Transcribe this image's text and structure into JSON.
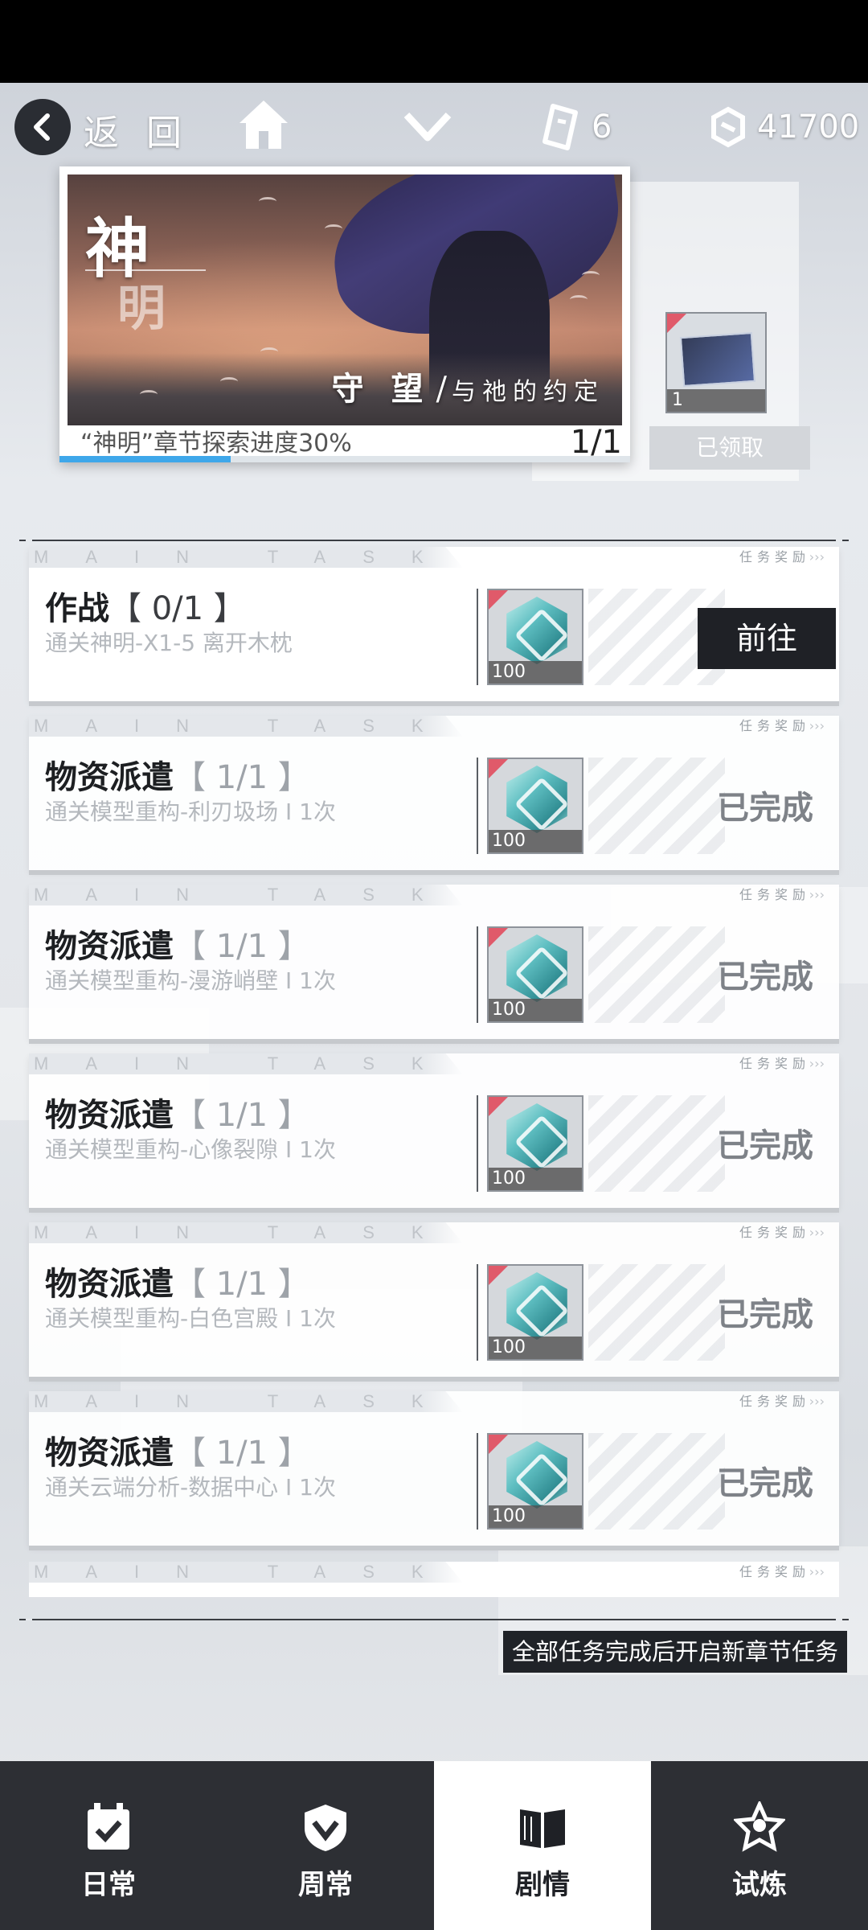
{
  "topbar": {
    "back_label": "返 回",
    "ticket_count": "6",
    "currency_amount": "41700"
  },
  "banner": {
    "chapter_name_1": "神",
    "chapter_name_2": "明",
    "subtitle_big": "守 望",
    "subtitle_sep": "/",
    "subtitle_small": "与祂的约定",
    "progress_label": "“神明”章节探索进度30%",
    "progress_count": "1/1",
    "progress_percent": 30
  },
  "chapter_reward": {
    "item_count": "1",
    "status": "已领取"
  },
  "tasks": [
    {
      "tag": "MAIN TASK",
      "reward_label": "任务奖励",
      "title": "作战",
      "count": "【 0/1 】",
      "desc": "通关神明-X1-5 离开木枕",
      "reward_qty": "100",
      "action": "前往",
      "done": false
    },
    {
      "tag": "MAIN TASK",
      "reward_label": "任务奖励",
      "title": "物资派遣",
      "count": "【 1/1 】",
      "desc": "通关模型重构-利刃圾场 I 1次",
      "reward_qty": "100",
      "action": "已完成",
      "done": true
    },
    {
      "tag": "MAIN TASK",
      "reward_label": "任务奖励",
      "title": "物资派遣",
      "count": "【 1/1 】",
      "desc": "通关模型重构-漫游峭壁 I 1次",
      "reward_qty": "100",
      "action": "已完成",
      "done": true
    },
    {
      "tag": "MAIN TASK",
      "reward_label": "任务奖励",
      "title": "物资派遣",
      "count": "【 1/1 】",
      "desc": "通关模型重构-心像裂隙 I 1次",
      "reward_qty": "100",
      "action": "已完成",
      "done": true
    },
    {
      "tag": "MAIN TASK",
      "reward_label": "任务奖励",
      "title": "物资派遣",
      "count": "【 1/1 】",
      "desc": "通关模型重构-白色宫殿 I 1次",
      "reward_qty": "100",
      "action": "已完成",
      "done": true
    },
    {
      "tag": "MAIN TASK",
      "reward_label": "任务奖励",
      "title": "物资派遣",
      "count": "【 1/1 】",
      "desc": "通关云端分析-数据中心 I 1次",
      "reward_qty": "100",
      "action": "已完成",
      "done": true
    }
  ],
  "last_row": {
    "tag": "MAIN TASK",
    "reward_label": "任务奖励"
  },
  "footer_note": "全部任务完成后开启新章节任务",
  "bottom_nav": [
    {
      "label": "日常",
      "icon": "calendar-check-icon",
      "active": false
    },
    {
      "label": "周常",
      "icon": "shield-check-icon",
      "active": false
    },
    {
      "label": "剧情",
      "icon": "open-book-icon",
      "active": true
    },
    {
      "label": "试炼",
      "icon": "trial-emblem-icon",
      "active": false
    }
  ],
  "colors": {
    "accent_blue": "#3ea7ea",
    "dark_button": "#1f2126",
    "nav_background": "#2d2f34",
    "reward_corner": "#e05a6a"
  }
}
